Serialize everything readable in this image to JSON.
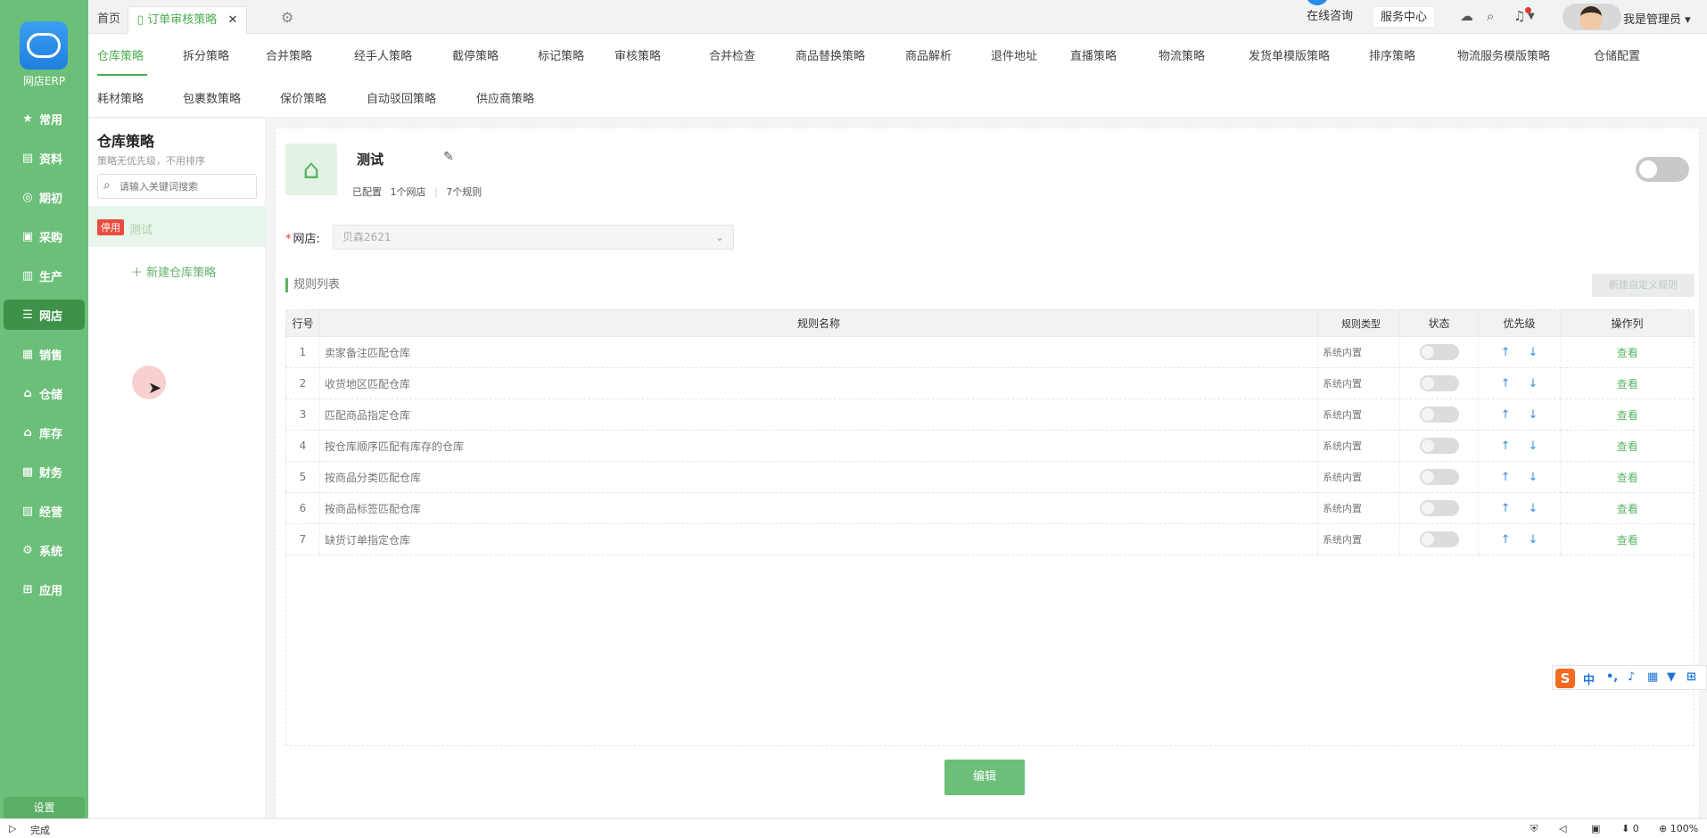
{
  "app": {
    "logo_text": "网店ERP"
  },
  "sidebar": {
    "items": [
      {
        "label": "常用",
        "icon": "★",
        "active": false
      },
      {
        "label": "资料",
        "icon": "▤",
        "active": false
      },
      {
        "label": "期初",
        "icon": "◎",
        "active": false
      },
      {
        "label": "采购",
        "icon": "▣",
        "active": false
      },
      {
        "label": "生产",
        "icon": "▥",
        "active": false
      },
      {
        "label": "网店",
        "icon": "☰",
        "active": true
      },
      {
        "label": "销售",
        "icon": "▦",
        "active": false
      },
      {
        "label": "仓储",
        "icon": "⌂",
        "active": false
      },
      {
        "label": "库存",
        "icon": "⌂",
        "active": false
      },
      {
        "label": "财务",
        "icon": "▩",
        "active": false
      },
      {
        "label": "经营",
        "icon": "▧",
        "active": false
      },
      {
        "label": "系统",
        "icon": "⚙",
        "active": false
      },
      {
        "label": "应用",
        "icon": "⊞",
        "active": false
      }
    ],
    "settings_label": "设置"
  },
  "topbar": {
    "tabs": [
      {
        "label": "首页",
        "active": false,
        "closable": false
      },
      {
        "label": "订单审核策略",
        "active": true,
        "closable": true
      }
    ],
    "online_consult": "在线咨询",
    "service_center": "服务中心",
    "user_name": "我是管理员"
  },
  "strategy_tabs": {
    "row1": [
      "仓库策略",
      "拆分策略",
      "合并策略",
      "经手人策略",
      "截停策略",
      "标记策略",
      "审核策略",
      "合并检查",
      "商品替换策略",
      "商品解析",
      "退件地址",
      "直播策略",
      "物流策略",
      "发货单模版策略",
      "排序策略",
      "物流服务模版策略",
      "仓储配置"
    ],
    "row2": [
      "耗材策略",
      "包裹数策略",
      "保价策略",
      "自动驳回策略",
      "供应商策略"
    ],
    "active": "仓库策略"
  },
  "list_panel": {
    "title": "仓库策略",
    "subtitle": "策略无优先级，不用排序",
    "search_placeholder": "请输入关键词搜索",
    "items": [
      {
        "badge": "停用",
        "label": "测试"
      }
    ],
    "new_label": "新建仓库策略"
  },
  "detail": {
    "name": "测试",
    "status_configured": "已配置",
    "store_count": "1个网店",
    "rule_count": "7个规则",
    "enabled": false,
    "store_label": "网店:",
    "store_value": "贝森2621",
    "rules_title": "规则列表",
    "new_rule_button": "新建自定义规则",
    "columns": [
      "行号",
      "规则名称",
      "规则类型",
      "状态",
      "优先级",
      "操作列"
    ],
    "rules": [
      {
        "no": "1",
        "name": "卖家备注匹配仓库",
        "type": "系统内置",
        "action": "查看"
      },
      {
        "no": "2",
        "name": "收货地区匹配仓库",
        "type": "系统内置",
        "action": "查看"
      },
      {
        "no": "3",
        "name": "匹配商品指定仓库",
        "type": "系统内置",
        "action": "查看"
      },
      {
        "no": "4",
        "name": "按仓库顺序匹配有库存的仓库",
        "type": "系统内置",
        "action": "查看"
      },
      {
        "no": "5",
        "name": "按商品分类匹配仓库",
        "type": "系统内置",
        "action": "查看"
      },
      {
        "no": "6",
        "name": "按商品标签匹配仓库",
        "type": "系统内置",
        "action": "查看"
      },
      {
        "no": "7",
        "name": "缺货订单指定仓库",
        "type": "系统内置",
        "action": "查看"
      }
    ],
    "edit_button": "编辑"
  },
  "ime": {
    "lang": "中",
    "punct": "•,"
  },
  "statusbar": {
    "status": "完成",
    "count": "0",
    "zoom": "100%"
  },
  "colors": {
    "primary": "#6cbf78",
    "active_nav": "#3d9149",
    "accent_green": "#4caf50",
    "badge_red": "#e74c3c",
    "link_blue": "#3b8fe5"
  }
}
